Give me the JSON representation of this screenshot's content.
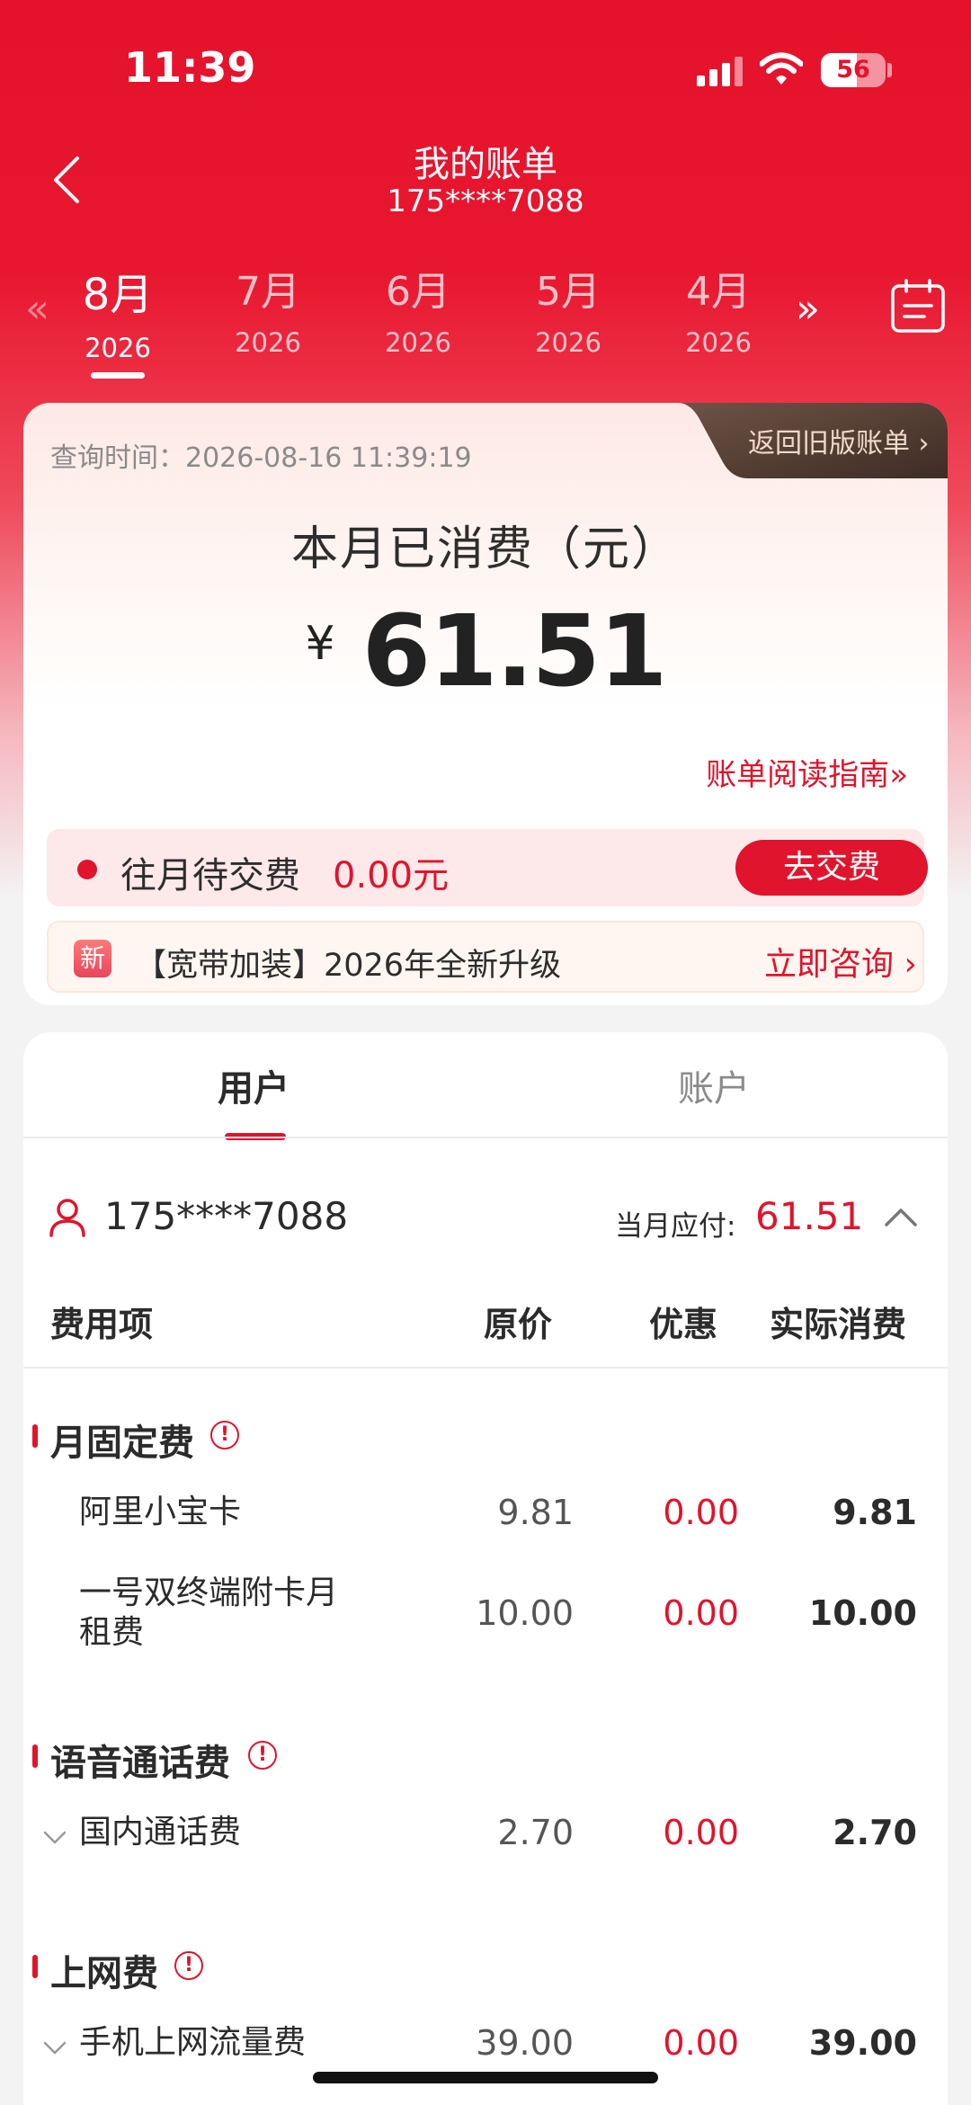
{
  "status_bar": {
    "time": "11:39",
    "battery": "56",
    "battery_level": 0.56
  },
  "header": {
    "title": "我的账单",
    "subtitle": "175****7088"
  },
  "months": [
    {
      "month": "8月",
      "year": "2026",
      "active": true
    },
    {
      "month": "7月",
      "year": "2026",
      "active": false
    },
    {
      "month": "6月",
      "year": "2026",
      "active": false
    },
    {
      "month": "5月",
      "year": "2026",
      "active": false
    },
    {
      "month": "4月",
      "year": "2026",
      "active": false
    }
  ],
  "summary": {
    "query_time": "查询时间：2026-08-16 11:39:19",
    "old_bill_link": "返回旧版账单",
    "spent_title": "本月已消费（元）",
    "currency": "¥",
    "amount": "61.51",
    "guide_link": "账单阅读指南",
    "due_label": "往月待交费",
    "due_amount": "0.00元",
    "pay_button": "去交费",
    "promo_badge": "新",
    "promo_text": "【宽带加装】2026年全新升级",
    "promo_link": "立即咨询"
  },
  "detail": {
    "tabs": [
      "用户",
      "账户"
    ],
    "user_phone": "175****7088",
    "due_month_label": "当月应付:",
    "due_month_value": "61.51",
    "columns": [
      "费用项",
      "原价",
      "优惠",
      "实际消费"
    ],
    "sections": [
      {
        "title": "月固定费",
        "items": [
          {
            "name": "阿里小宝卡",
            "original": "9.81",
            "discount": "0.00",
            "actual": "9.81"
          },
          {
            "name": "一号双终端附卡月租费",
            "original": "10.00",
            "discount": "0.00",
            "actual": "10.00"
          }
        ]
      },
      {
        "title": "语音通话费",
        "items": [
          {
            "name": "国内通话费",
            "original": "2.70",
            "discount": "0.00",
            "actual": "2.70"
          }
        ]
      },
      {
        "title": "上网费",
        "items": [
          {
            "name": "手机上网流量费",
            "original": "39.00",
            "discount": "0.00",
            "actual": "39.00"
          }
        ]
      }
    ]
  },
  "colors": {
    "brand_red": "#e0142c",
    "header_red": "#e6122c"
  }
}
